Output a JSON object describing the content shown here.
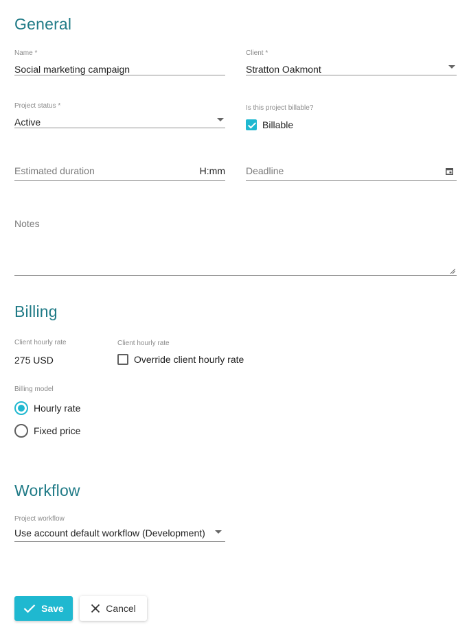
{
  "general": {
    "title": "General",
    "name": {
      "label": "Name *",
      "value": "Social marketing campaign"
    },
    "client": {
      "label": "Client *",
      "value": "Stratton Oakmont"
    },
    "project_status": {
      "label": "Project status *",
      "value": "Active"
    },
    "billable": {
      "label": "Is this project billable?",
      "option": "Billable",
      "checked": true
    },
    "estimated_duration": {
      "placeholder": "Estimated duration",
      "suffix": "H:mm"
    },
    "deadline": {
      "placeholder": "Deadline",
      "icon": "calendar-icon"
    },
    "notes": {
      "placeholder": "Notes"
    }
  },
  "billing": {
    "title": "Billing",
    "client_rate": {
      "label": "Client hourly rate",
      "value": "275 USD"
    },
    "override": {
      "label": "Client hourly rate",
      "option": "Override client hourly rate",
      "checked": false
    },
    "billing_model": {
      "label": "Billing model",
      "options": [
        "Hourly rate",
        "Fixed price"
      ],
      "selected": "Hourly rate"
    }
  },
  "workflow": {
    "title": "Workflow",
    "project_workflow": {
      "label": "Project workflow",
      "value": "Use account default workflow (Development)"
    }
  },
  "actions": {
    "save": "Save",
    "cancel": "Cancel"
  },
  "colors": {
    "accent": "#1fb8d0",
    "heading": "#1f7a86"
  }
}
